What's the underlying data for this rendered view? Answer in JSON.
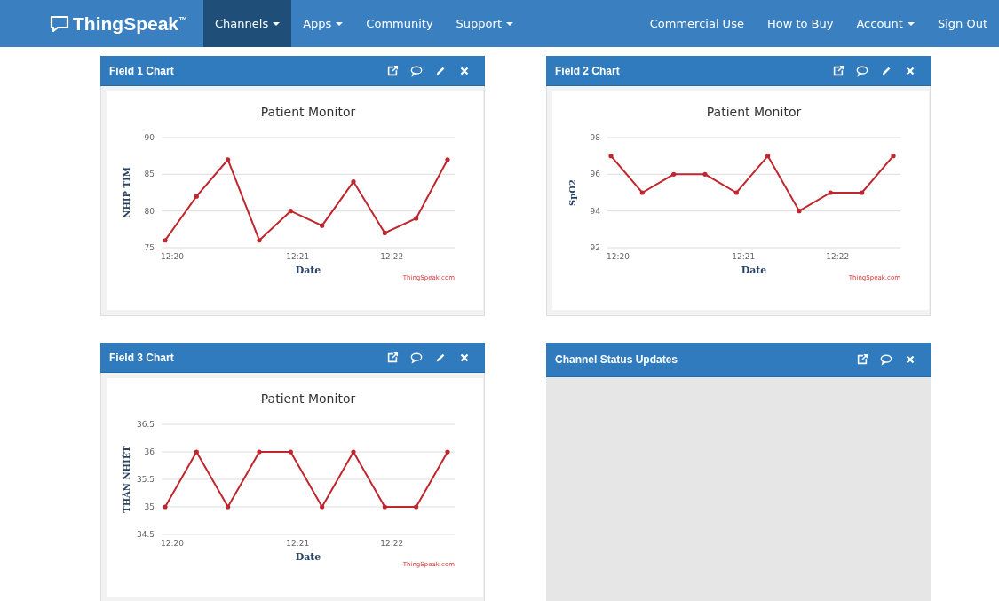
{
  "navbar": {
    "logo": "ThingSpeak$^{™}$",
    "left_items": [
      {
        "label": "Channels",
        "dropdown": true,
        "selected": true
      },
      {
        "label": "Apps",
        "dropdown": true,
        "selected": false
      },
      {
        "label": "Community",
        "dropdown": false,
        "selected": false
      },
      {
        "label": "Support",
        "dropdown": true,
        "selected": false
      }
    ],
    "right_items": [
      {
        "label": "Commercial Use",
        "dropdown": false,
        "selected": false
      },
      {
        "label": "How to Buy",
        "dropdown": false,
        "selected": false
      },
      {
        "label": "Account",
        "dropdown": true,
        "selected": false
      },
      {
        "label": "Sign Out",
        "dropdown": false,
        "selected": false
      }
    ]
  },
  "panels": [
    {
      "title": "Field 1 Chart",
      "kind": "chart",
      "actions": [
        {
          "kind": "external"
        },
        {
          "kind": "comment"
        },
        {
          "kind": "edit"
        },
        {
          "kind": "close"
        }
      ],
      "credit": "ThingSpeak.com",
      "chart_data": {
        "type": "line",
        "title": "Patient Monitor",
        "xlabel": "Date",
        "ylabel": "NHỊP TIM",
        "categories": [
          "12:20",
          null,
          null,
          null,
          "12:21",
          null,
          null,
          "12:22",
          null,
          null
        ],
        "series": [
          {
            "color": "#c0262d",
            "values": [
              76,
              82,
              87,
              76,
              80,
              78,
              84,
              77,
              79,
              87
            ]
          }
        ],
        "grid": true,
        "ylim": [
          75,
          90
        ],
        "yticks": [
          75,
          80,
          85,
          90
        ]
      }
    },
    {
      "title": "Field 2 Chart",
      "kind": "chart",
      "actions": [
        {
          "kind": "external"
        },
        {
          "kind": "comment"
        },
        {
          "kind": "edit"
        },
        {
          "kind": "close"
        }
      ],
      "credit": "ThingSpeak.com",
      "chart_data": {
        "type": "line",
        "title": "Patient Monitor",
        "xlabel": "Date",
        "ylabel": "SpO2",
        "categories": [
          "12:20",
          null,
          null,
          null,
          "12:21",
          null,
          null,
          "12:22",
          null,
          null
        ],
        "series": [
          {
            "color": "#c0262d",
            "values": [
              97,
              95,
              96,
              96,
              95,
              97,
              94,
              95,
              95,
              97
            ]
          }
        ],
        "grid": true,
        "ylim": [
          92,
          98
        ],
        "yticks": [
          92,
          94,
          96,
          98
        ]
      }
    },
    {
      "title": "Field 3 Chart",
      "kind": "chart",
      "actions": [
        {
          "kind": "external"
        },
        {
          "kind": "comment"
        },
        {
          "kind": "edit"
        },
        {
          "kind": "close"
        }
      ],
      "credit": "ThingSpeak.com",
      "chart_data": {
        "type": "line",
        "title": "Patient Monitor",
        "xlabel": "Date",
        "ylabel": "THÂN NHIỆT",
        "categories": [
          "12:20",
          null,
          null,
          null,
          "12:21",
          null,
          null,
          "12:22",
          null,
          null
        ],
        "series": [
          {
            "color": "#c0262d",
            "values": [
              35,
              36,
              35,
              36,
              36,
              35,
              36,
              35,
              35,
              36
            ]
          }
        ],
        "grid": true,
        "ylim": [
          34.5,
          36.5
        ],
        "yticks": [
          34.5,
          35,
          35.5,
          36,
          36.5
        ]
      }
    },
    {
      "title": "Channel Status Updates",
      "kind": "status",
      "actions": [
        {
          "kind": "external"
        },
        {
          "kind": "comment"
        },
        {
          "kind": "close"
        }
      ]
    }
  ]
}
